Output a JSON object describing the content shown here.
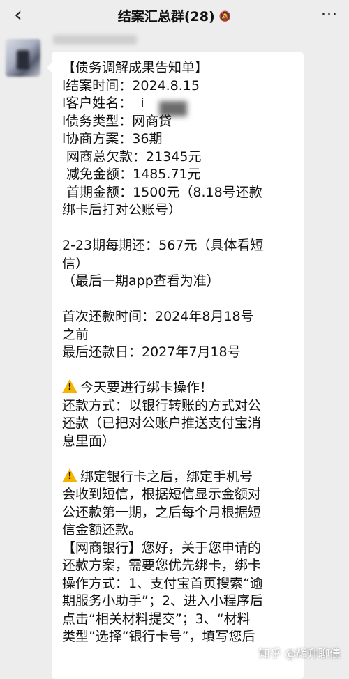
{
  "nav": {
    "back_icon": "chevron-left-icon",
    "title": "结案汇总群(28)",
    "mute_icon": "bell-off-icon",
    "more_icon": "ellipsis-icon"
  },
  "message": {
    "lines": [
      {
        "text": "【债务调解成果告知单】"
      },
      {
        "text": "l结案时间：2024.8.15"
      },
      {
        "text": "l客户姓名：  i"
      },
      {
        "text": "l债务类型：网商贷"
      },
      {
        "text": "l协商方案：36期"
      },
      {
        "text": " 网商总欠款：21345元"
      },
      {
        "text": " 减免金额：1485.71元"
      },
      {
        "text": " 首期金额：1500元（8.18号还款"
      },
      {
        "text": "绑卡后打对公账号）"
      },
      {
        "text": ""
      },
      {
        "text": "2-23期每期还：567元（具体看短"
      },
      {
        "text": "信）"
      },
      {
        "text": "（最后一期app查看为准）"
      },
      {
        "text": ""
      },
      {
        "text": "首次还款时间：2024年8月18号"
      },
      {
        "text": "之前"
      },
      {
        "text": "最后还款日：2027年7月18号"
      },
      {
        "text": ""
      },
      {
        "text": "今天要进行绑卡操作！",
        "warn": true
      },
      {
        "text": "还款方式：以银行转账的方式对公"
      },
      {
        "text": "还款（已把对公账户推送支付宝消"
      },
      {
        "text": "息里面）"
      },
      {
        "text": ""
      },
      {
        "text": "绑定银行卡之后，绑定手机号",
        "warn": true
      },
      {
        "text": "会收到短信，根据短信显示金额对"
      },
      {
        "text": "公还款第一期，之后每个月根据短"
      },
      {
        "text": "信金额还款。"
      },
      {
        "text": "【网商银行】您好，关于您申请的"
      },
      {
        "text": "还款方案，需要您优先绑卡，绑卡"
      },
      {
        "text": "操作方式：1、支付宝首页搜索“逾"
      },
      {
        "text": "期服务小助手”；2、进入小程序后"
      },
      {
        "text": "点击“相关材料提交”；3、“材料"
      },
      {
        "text": "类型”选择“银行卡号”，填写您后"
      }
    ],
    "warning_icon": "warning-icon"
  },
  "watermark": "知乎 @辉升聊债"
}
